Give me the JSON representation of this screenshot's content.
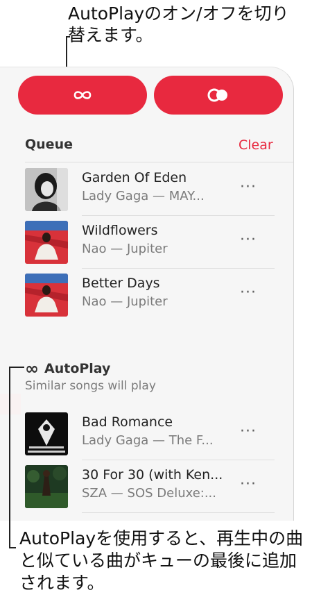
{
  "callouts": {
    "top": "AutoPlayのオン/オフを切り替えます。",
    "bottom": "AutoPlayを使用すると、再生中の曲と似ている曲がキューの最後に追加されます。"
  },
  "buttons": {
    "autoplay_icon": "infinity-icon",
    "shuffle_icon": "autoplay-toggle-icon",
    "accent": "#e8293f"
  },
  "queue": {
    "title": "Queue",
    "clear_label": "Clear",
    "items": [
      {
        "title": "Garden Of Eden",
        "subtitle": "Lady Gaga — MAY...",
        "more": "···"
      },
      {
        "title": "Wildflowers",
        "subtitle": "Nao — Jupiter",
        "more": "···"
      },
      {
        "title": "Better Days",
        "subtitle": "Nao — Jupiter",
        "more": "···"
      }
    ]
  },
  "autoplay": {
    "icon": "∞",
    "title": "AutoPlay",
    "subtitle": "Similar songs will play",
    "items": [
      {
        "title": "Bad Romance",
        "subtitle": "Lady Gaga — The F...",
        "more": "···"
      },
      {
        "title": "30 For 30 (with Ken...",
        "subtitle": "SZA — SOS Deluxe:...",
        "more": "···"
      }
    ]
  }
}
